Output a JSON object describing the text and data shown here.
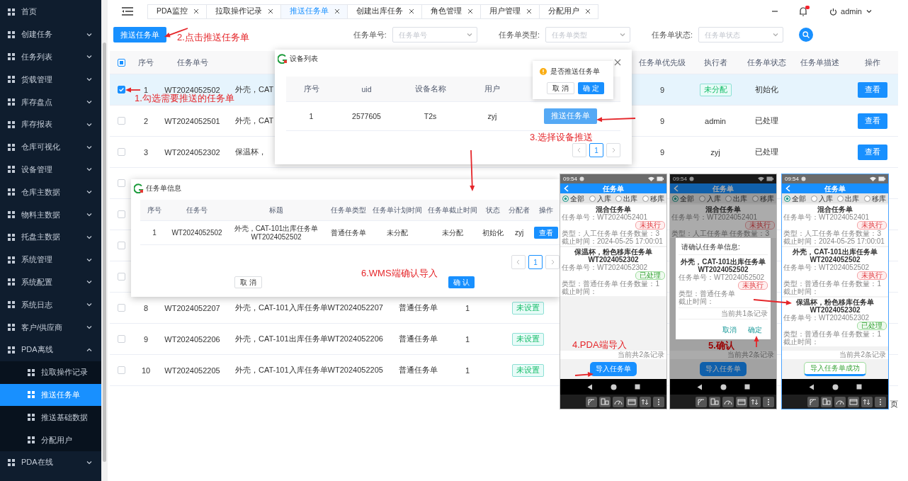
{
  "sidebar": {
    "items": [
      {
        "label": "首页"
      },
      {
        "label": "创建任务",
        "expanded": false
      },
      {
        "label": "任务列表",
        "expanded": false
      },
      {
        "label": "货载管理",
        "expanded": false
      },
      {
        "label": "库存盘点",
        "expanded": false
      },
      {
        "label": "库存报表",
        "expanded": false
      },
      {
        "label": "仓库可视化",
        "expanded": false
      },
      {
        "label": "设备管理",
        "expanded": false
      },
      {
        "label": "仓库主数据",
        "expanded": false
      },
      {
        "label": "物料主数据",
        "expanded": false
      },
      {
        "label": "托盘主数据",
        "expanded": false
      },
      {
        "label": "系统管理",
        "expanded": false
      },
      {
        "label": "系统配置",
        "expanded": false
      },
      {
        "label": "系统日志",
        "expanded": false
      },
      {
        "label": "客户/供应商",
        "expanded": false
      },
      {
        "label": "PDA离线",
        "expanded": true,
        "children": [
          {
            "label": "拉取操作记录",
            "selected": false
          },
          {
            "label": "推送任务单",
            "selected": true
          },
          {
            "label": "推送基础数据",
            "selected": false
          },
          {
            "label": "分配用户",
            "selected": false
          }
        ]
      },
      {
        "label": "PDA在线",
        "expanded": false
      }
    ]
  },
  "header": {
    "tabs": [
      {
        "label": "PDA监控",
        "selected": false
      },
      {
        "label": "拉取操作记录",
        "selected": false
      },
      {
        "label": "推送任务单",
        "selected": true
      },
      {
        "label": "创建出库任务",
        "selected": false
      },
      {
        "label": "角色管理",
        "selected": false
      },
      {
        "label": "用户管理",
        "selected": false
      },
      {
        "label": "分配用户",
        "selected": false
      }
    ],
    "user": "admin"
  },
  "toolbar": {
    "push_button": "推送任务单",
    "filters": [
      {
        "label": "任务单号:",
        "placeholder": "任务单号"
      },
      {
        "label": "任务单类型:",
        "placeholder": "任务单类型"
      },
      {
        "label": "任务单状态:",
        "placeholder": "任务单状态"
      }
    ]
  },
  "table": {
    "select_all_partial": true,
    "columns": {
      "seq": "序号",
      "id": "任务单号",
      "priority": "任务单优先级",
      "executor": "执行者",
      "status": "任务单状态",
      "description": "任务单描述",
      "action": "操作"
    },
    "rows": [
      {
        "checked": true,
        "selected": true,
        "seq": "1",
        "id": "WT2024052502",
        "title": "外壳，CAT",
        "priority": "9",
        "executor_tag": "未分配",
        "status": "初始化",
        "action": "查看"
      },
      {
        "checked": false,
        "selected": false,
        "seq": "2",
        "id": "WT2024052501",
        "title": "外壳，CAT",
        "priority": "9",
        "executor": "admin",
        "status": "已处理",
        "action": "查看"
      },
      {
        "checked": false,
        "selected": false,
        "seq": "3",
        "id": "WT2024052302",
        "title": "保温杯，",
        "priority": "9",
        "executor": "zyj",
        "status": "已处理",
        "action": "查看"
      },
      {
        "checked": false,
        "selected": false
      },
      {
        "checked": false,
        "selected": false
      },
      {
        "checked": false,
        "selected": false
      },
      {
        "checked": false,
        "selected": false
      },
      {
        "checked": false,
        "selected": false,
        "seq": "8",
        "id": "WT2024052207",
        "title": "外壳，CAT-101入库任务单WT2024052207",
        "type": "普通任务单",
        "count": "1",
        "tag": "未设置"
      },
      {
        "checked": false,
        "selected": false,
        "seq": "9",
        "id": "WT2024052206",
        "title": "外壳，CAT-101出库任务单WT2024052206",
        "type": "普通任务单",
        "count": "1",
        "tag": "未设置"
      },
      {
        "checked": false,
        "selected": false,
        "seq": "10",
        "id": "WT2024052205",
        "title": "外壳，CAT-101入库任务单WT2024052205",
        "type": "普通任务单",
        "count": "1",
        "tag": "未设置"
      }
    ]
  },
  "pagination": {
    "text": "页"
  },
  "device_dialog": {
    "title": "设备列表",
    "columns": [
      "序号",
      "uid",
      "设备名称",
      "用户"
    ],
    "rows": [
      {
        "cells": [
          "1",
          "2577605",
          "T2s",
          "zyj"
        ],
        "action": "推送任务单"
      }
    ],
    "pages": [
      {
        "label": "1",
        "selected": true
      }
    ],
    "popconfirm": {
      "message": "是否推送任务单",
      "cancel": "取 消",
      "confirm": "确 定"
    }
  },
  "task_dialog": {
    "title": "任务单信息",
    "columns": [
      "序号",
      "任务号",
      "标题",
      "任务单类型",
      "任务单计划时间",
      "任务单截止时间",
      "状态",
      "分配者",
      "操作"
    ],
    "rows": [
      {
        "cells": [
          "1",
          "WT2024052502",
          "外壳，CAT-101出库任务单WT2024052502",
          "普通任务单",
          "未分配",
          "未分配",
          "初始化",
          "zyj"
        ],
        "action": "查看"
      }
    ],
    "pages": [
      {
        "label": "1",
        "selected": true
      }
    ],
    "cancel": "取 消",
    "confirm": "确 认"
  },
  "phones": [
    {
      "time": "09:54",
      "title": "任务单",
      "filters": [
        {
          "label": "全部",
          "selected": true
        },
        {
          "label": "入库",
          "selected": false
        },
        {
          "label": "出库",
          "selected": false
        },
        {
          "label": "移库",
          "selected": false
        }
      ],
      "cards": [
        {
          "title": "混合任务单",
          "id": "任务单号：WT2024052401",
          "badge": {
            "text": "未执行",
            "kind": "pending"
          },
          "type": "类型：人工任务单",
          "count": "任务数量：3",
          "deadline": "截止时间：2024-05-25 17:00:01"
        },
        {
          "title": "保温杯，粉色移库任务单WT2024052302",
          "id": "任务单号：WT2024052302",
          "badge": {
            "text": "已处理",
            "kind": "done"
          },
          "type": "类型：普通任务单",
          "count": "任务数量：1",
          "deadline": "截止时间："
        }
      ],
      "footer": "当前共2条记录",
      "button": {
        "label": "导入任务单",
        "kind": "primary"
      },
      "dimmed": false
    },
    {
      "time": "09:54",
      "title": "任务单",
      "filters": [
        {
          "label": "全部",
          "selected": true
        },
        {
          "label": "入库",
          "selected": false
        },
        {
          "label": "出库",
          "selected": false
        },
        {
          "label": "移库",
          "selected": false
        }
      ],
      "cards": [
        {
          "title": "混合任务单",
          "id": "任务单号：WT2024052401",
          "badge": {
            "text": "未执行",
            "kind": "pending"
          },
          "type": "类型：人工任务单",
          "count": "任务数量：3"
        }
      ],
      "footer": "当前共2条记录",
      "button": {
        "label": "导入任务单",
        "kind": "primary"
      },
      "dimmed": true,
      "modal": {
        "heading": "请确认任务单信息:",
        "title": "外壳，CAT-101出库任务单WT2024052502",
        "id": "任务单号：WT2024052502",
        "badge": {
          "text": "未执行",
          "kind": "pending"
        },
        "type": "类型：普通任务单",
        "deadline": "截止时间：",
        "footer": "当前共1条记录",
        "cancel": "取消",
        "confirm": "确定"
      }
    },
    {
      "time": "09:54",
      "title": "任务单",
      "filters": [
        {
          "label": "全部",
          "selected": true
        },
        {
          "label": "入库",
          "selected": false
        },
        {
          "label": "出库",
          "selected": false
        },
        {
          "label": "移库",
          "selected": false
        }
      ],
      "cards": [
        {
          "title": "混合任务单",
          "id": "任务单号：WT2024052401",
          "badge": {
            "text": "未执行",
            "kind": "pending"
          },
          "type": "类型：人工任务单",
          "count": "任务数量：3",
          "deadline": "截止时间：2024-05-25 17:00:01"
        },
        {
          "title": "外壳，CAT-101出库任务单WT2024052502",
          "id": "任务单号：WT2024052502",
          "badge": {
            "text": "未执行",
            "kind": "pending"
          },
          "type": "类型：普通任务单",
          "count": "任务数量：1",
          "deadline": "截止时间："
        },
        {
          "title": "保温杯，粉色移库任务单WT2024052302",
          "id": "任务单号：WT2024052302",
          "badge": {
            "text": "已处理",
            "kind": "done"
          },
          "type": "类型：普通任务单",
          "count": "任务数量：1",
          "deadline": "截止时间："
        }
      ],
      "footer": "当前共2条记录",
      "button": {
        "label": "导入任务单成功",
        "kind": "success"
      },
      "dimmed": false
    }
  ],
  "annotations": [
    "2.点击推送任务单",
    "1.勾选需要推送的任务单",
    "3.选择设备推送",
    "6.WMS端确认导入",
    "4.PDA端导入",
    "5.确认"
  ]
}
